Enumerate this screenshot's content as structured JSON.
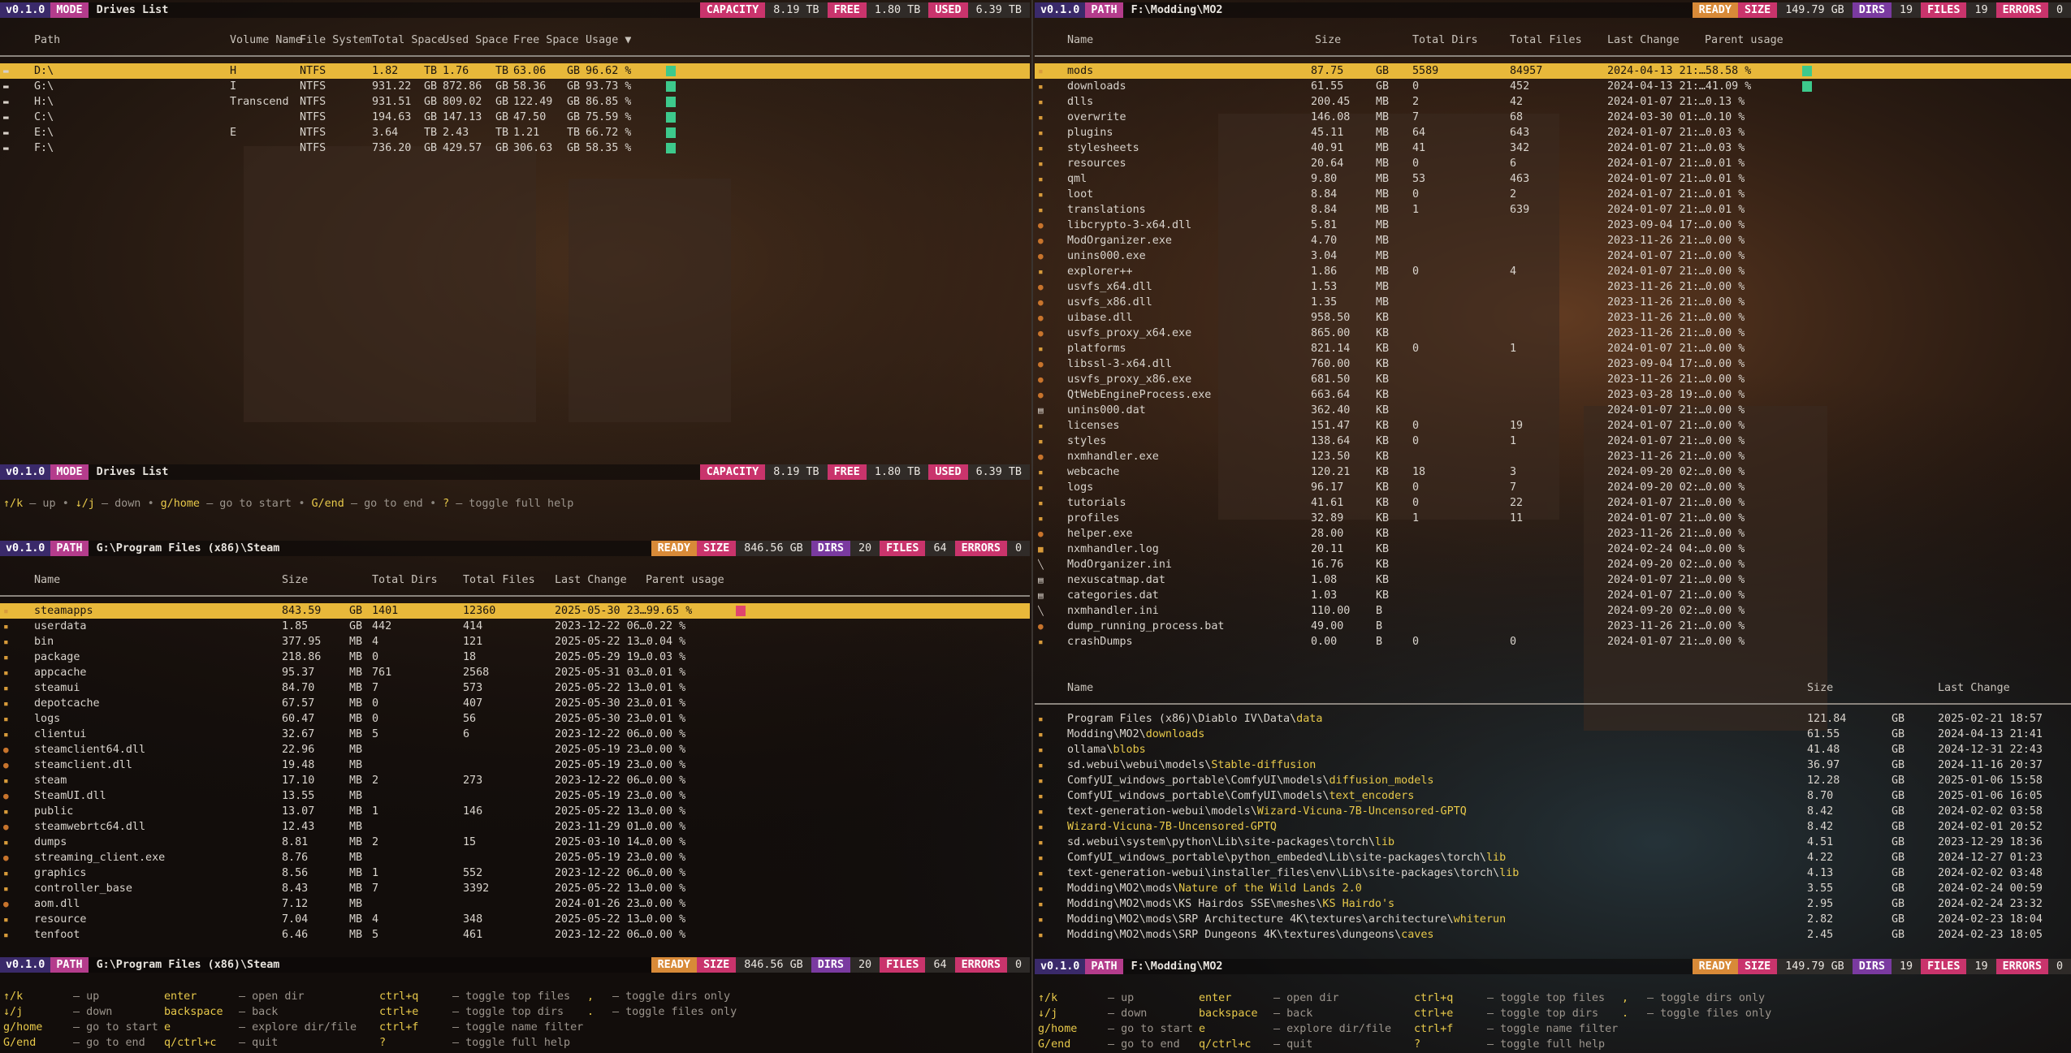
{
  "version": "v0.1.0",
  "drives": {
    "mode_label": "MODE",
    "title": "Drives List",
    "stats": {
      "capacity_label": "CAPACITY",
      "capacity": "8.19 TB",
      "free_label": "FREE",
      "free": "1.80 TB",
      "used_label": "USED",
      "used": "6.39 TB"
    },
    "columns": [
      "Path",
      "Volume Name",
      "File System",
      "Total Space",
      "Used Space",
      "Free Space",
      "Usage ▼"
    ],
    "rows": [
      {
        "path": "D:\\",
        "vol": "H",
        "fs": "NTFS",
        "total": "1.82",
        "tu": "TB",
        "used": "1.76",
        "uu": "TB",
        "free": "63.06",
        "fu": "GB",
        "usage": "96.62 %",
        "pct": 96.62
      },
      {
        "path": "G:\\",
        "vol": "I",
        "fs": "NTFS",
        "total": "931.22",
        "tu": "GB",
        "used": "872.86",
        "uu": "GB",
        "free": "58.36",
        "fu": "GB",
        "usage": "93.73 %",
        "pct": 93.73
      },
      {
        "path": "H:\\",
        "vol": "Transcend",
        "fs": "NTFS",
        "total": "931.51",
        "tu": "GB",
        "used": "809.02",
        "uu": "GB",
        "free": "122.49",
        "fu": "GB",
        "usage": "86.85 %",
        "pct": 86.85
      },
      {
        "path": "C:\\",
        "vol": "",
        "fs": "NTFS",
        "total": "194.63",
        "tu": "GB",
        "used": "147.13",
        "uu": "GB",
        "free": "47.50",
        "fu": "GB",
        "usage": "75.59 %",
        "pct": 75.59
      },
      {
        "path": "E:\\",
        "vol": "E",
        "fs": "NTFS",
        "total": "3.64",
        "tu": "TB",
        "used": "2.43",
        "uu": "TB",
        "free": "1.21",
        "fu": "TB",
        "usage": "66.72 %",
        "pct": 66.72
      },
      {
        "path": "F:\\",
        "vol": "",
        "fs": "NTFS",
        "total": "736.20",
        "tu": "GB",
        "used": "429.57",
        "uu": "GB",
        "free": "306.63",
        "fu": "GB",
        "usage": "58.35 %",
        "pct": 58.35
      }
    ],
    "help": [
      {
        "k": "↑/k",
        "d": "– up"
      },
      {
        "k": "↓/j",
        "d": "– down"
      },
      {
        "k": "g/home",
        "d": "– go to start"
      },
      {
        "k": "G/end",
        "d": "– go to end"
      },
      {
        "k": "?",
        "d": "– toggle full help"
      }
    ]
  },
  "steam": {
    "path_label": "PATH",
    "path": "G:\\Program Files (x86)\\Steam",
    "stats": {
      "ready": "READY",
      "size_label": "SIZE",
      "size": "846.56 GB",
      "dirs_label": "DIRS",
      "dirs": "20",
      "files_label": "FILES",
      "files": "64",
      "errors_label": "ERRORS",
      "errors": "0"
    },
    "columns": [
      "Name",
      "Size",
      "Total Dirs",
      "Total Files",
      "Last Change",
      "Parent usage"
    ],
    "rows": [
      {
        "i": "d",
        "n": "steamapps",
        "s": "843.59",
        "u": "GB",
        "td": "1401",
        "tf": "12360",
        "lc": "2025-05-30 23…99.65 %",
        "pct": 99.65
      },
      {
        "i": "d",
        "n": "userdata",
        "s": "1.85",
        "u": "GB",
        "td": "442",
        "tf": "414",
        "lc": "2023-12-22 06…0.22 %"
      },
      {
        "i": "d",
        "n": "bin",
        "s": "377.95",
        "u": "MB",
        "td": "4",
        "tf": "121",
        "lc": "2025-05-22 13…0.04 %"
      },
      {
        "i": "d",
        "n": "package",
        "s": "218.86",
        "u": "MB",
        "td": "0",
        "tf": "18",
        "lc": "2025-05-29 19…0.03 %"
      },
      {
        "i": "d",
        "n": "appcache",
        "s": "95.37",
        "u": "MB",
        "td": "761",
        "tf": "2568",
        "lc": "2025-05-31 03…0.01 %"
      },
      {
        "i": "d",
        "n": "steamui",
        "s": "84.70",
        "u": "MB",
        "td": "7",
        "tf": "573",
        "lc": "2025-05-22 13…0.01 %"
      },
      {
        "i": "d",
        "n": "depotcache",
        "s": "67.57",
        "u": "MB",
        "td": "0",
        "tf": "407",
        "lc": "2025-05-30 23…0.01 %"
      },
      {
        "i": "d",
        "n": "logs",
        "s": "60.47",
        "u": "MB",
        "td": "0",
        "tf": "56",
        "lc": "2025-05-30 23…0.01 %"
      },
      {
        "i": "d",
        "n": "clientui",
        "s": "32.67",
        "u": "MB",
        "td": "5",
        "tf": "6",
        "lc": "2023-12-22 06…0.00 %"
      },
      {
        "i": "f",
        "n": "steamclient64.dll",
        "s": "22.96",
        "u": "MB",
        "td": "",
        "tf": "",
        "lc": "2025-05-19 23…0.00 %"
      },
      {
        "i": "f",
        "n": "steamclient.dll",
        "s": "19.48",
        "u": "MB",
        "td": "",
        "tf": "",
        "lc": "2025-05-19 23…0.00 %"
      },
      {
        "i": "d",
        "n": "steam",
        "s": "17.10",
        "u": "MB",
        "td": "2",
        "tf": "273",
        "lc": "2023-12-22 06…0.00 %"
      },
      {
        "i": "f",
        "n": "SteamUI.dll",
        "s": "13.55",
        "u": "MB",
        "td": "",
        "tf": "",
        "lc": "2025-05-19 23…0.00 %"
      },
      {
        "i": "d",
        "n": "public",
        "s": "13.07",
        "u": "MB",
        "td": "1",
        "tf": "146",
        "lc": "2025-05-22 13…0.00 %"
      },
      {
        "i": "f",
        "n": "steamwebrtc64.dll",
        "s": "12.43",
        "u": "MB",
        "td": "",
        "tf": "",
        "lc": "2023-11-29 01…0.00 %"
      },
      {
        "i": "d",
        "n": "dumps",
        "s": "8.81",
        "u": "MB",
        "td": "2",
        "tf": "15",
        "lc": "2025-03-10 14…0.00 %"
      },
      {
        "i": "f",
        "n": "streaming_client.exe",
        "s": "8.76",
        "u": "MB",
        "td": "",
        "tf": "",
        "lc": "2025-05-19 23…0.00 %"
      },
      {
        "i": "d",
        "n": "graphics",
        "s": "8.56",
        "u": "MB",
        "td": "1",
        "tf": "552",
        "lc": "2023-12-22 06…0.00 %"
      },
      {
        "i": "d",
        "n": "controller_base",
        "s": "8.43",
        "u": "MB",
        "td": "7",
        "tf": "3392",
        "lc": "2025-05-22 13…0.00 %"
      },
      {
        "i": "f",
        "n": "aom.dll",
        "s": "7.12",
        "u": "MB",
        "td": "",
        "tf": "",
        "lc": "2024-01-26 23…0.00 %"
      },
      {
        "i": "d",
        "n": "resource",
        "s": "7.04",
        "u": "MB",
        "td": "4",
        "tf": "348",
        "lc": "2025-05-22 13…0.00 %"
      },
      {
        "i": "d",
        "n": "tenfoot",
        "s": "6.46",
        "u": "MB",
        "td": "5",
        "tf": "461",
        "lc": "2023-12-22 06…0.00 %"
      }
    ]
  },
  "mo2": {
    "path_label": "PATH",
    "path": "F:\\Modding\\MO2",
    "stats": {
      "ready": "READY",
      "size_label": "SIZE",
      "size": "149.79 GB",
      "dirs_label": "DIRS",
      "dirs": "19",
      "files_label": "FILES",
      "files": "19",
      "errors_label": "ERRORS",
      "errors": "0"
    },
    "columns": [
      "Name",
      "Size",
      "Total Dirs",
      "Total Files",
      "Last Change",
      "Parent usage"
    ],
    "rows": [
      {
        "i": "d",
        "n": "mods",
        "s": "87.75",
        "u": "GB",
        "td": "5589",
        "tf": "84957",
        "lc": "2024-04-13 21:…58.58 %",
        "pct": 58.58
      },
      {
        "i": "d",
        "n": "downloads",
        "s": "61.55",
        "u": "GB",
        "td": "0",
        "tf": "452",
        "lc": "2024-04-13 21:…41.09 %",
        "pct": 41.09
      },
      {
        "i": "d",
        "n": "dlls",
        "s": "200.45",
        "u": "MB",
        "td": "2",
        "tf": "42",
        "lc": "2024-01-07 21:…0.13 %"
      },
      {
        "i": "d",
        "n": "overwrite",
        "s": "146.08",
        "u": "MB",
        "td": "7",
        "tf": "68",
        "lc": "2024-03-30 01:…0.10 %"
      },
      {
        "i": "d",
        "n": "plugins",
        "s": "45.11",
        "u": "MB",
        "td": "64",
        "tf": "643",
        "lc": "2024-01-07 21:…0.03 %"
      },
      {
        "i": "d",
        "n": "stylesheets",
        "s": "40.91",
        "u": "MB",
        "td": "41",
        "tf": "342",
        "lc": "2024-01-07 21:…0.03 %"
      },
      {
        "i": "d",
        "n": "resources",
        "s": "20.64",
        "u": "MB",
        "td": "0",
        "tf": "6",
        "lc": "2024-01-07 21:…0.01 %"
      },
      {
        "i": "d",
        "n": "qml",
        "s": "9.80",
        "u": "MB",
        "td": "53",
        "tf": "463",
        "lc": "2024-01-07 21:…0.01 %"
      },
      {
        "i": "d",
        "n": "loot",
        "s": "8.84",
        "u": "MB",
        "td": "0",
        "tf": "2",
        "lc": "2024-01-07 21:…0.01 %"
      },
      {
        "i": "d",
        "n": "translations",
        "s": "8.84",
        "u": "MB",
        "td": "1",
        "tf": "639",
        "lc": "2024-01-07 21:…0.01 %"
      },
      {
        "i": "f",
        "n": "libcrypto-3-x64.dll",
        "s": "5.81",
        "u": "MB",
        "td": "",
        "tf": "",
        "lc": "2023-09-04 17:…0.00 %"
      },
      {
        "i": "f",
        "n": "ModOrganizer.exe",
        "s": "4.70",
        "u": "MB",
        "td": "",
        "tf": "",
        "lc": "2023-11-26 21:…0.00 %"
      },
      {
        "i": "f",
        "n": "unins000.exe",
        "s": "3.04",
        "u": "MB",
        "td": "",
        "tf": "",
        "lc": "2024-01-07 21:…0.00 %"
      },
      {
        "i": "d",
        "n": "explorer++",
        "s": "1.86",
        "u": "MB",
        "td": "0",
        "tf": "4",
        "lc": "2024-01-07 21:…0.00 %"
      },
      {
        "i": "f",
        "n": "usvfs_x64.dll",
        "s": "1.53",
        "u": "MB",
        "td": "",
        "tf": "",
        "lc": "2023-11-26 21:…0.00 %"
      },
      {
        "i": "f",
        "n": "usvfs_x86.dll",
        "s": "1.35",
        "u": "MB",
        "td": "",
        "tf": "",
        "lc": "2023-11-26 21:…0.00 %"
      },
      {
        "i": "f",
        "n": "uibase.dll",
        "s": "958.50",
        "u": "KB",
        "td": "",
        "tf": "",
        "lc": "2023-11-26 21:…0.00 %"
      },
      {
        "i": "f",
        "n": "usvfs_proxy_x64.exe",
        "s": "865.00",
        "u": "KB",
        "td": "",
        "tf": "",
        "lc": "2023-11-26 21:…0.00 %"
      },
      {
        "i": "d",
        "n": "platforms",
        "s": "821.14",
        "u": "KB",
        "td": "0",
        "tf": "1",
        "lc": "2024-01-07 21:…0.00 %"
      },
      {
        "i": "f",
        "n": "libssl-3-x64.dll",
        "s": "760.00",
        "u": "KB",
        "td": "",
        "tf": "",
        "lc": "2023-09-04 17:…0.00 %"
      },
      {
        "i": "f",
        "n": "usvfs_proxy_x86.exe",
        "s": "681.50",
        "u": "KB",
        "td": "",
        "tf": "",
        "lc": "2023-11-26 21:…0.00 %"
      },
      {
        "i": "f",
        "n": "QtWebEngineProcess.exe",
        "s": "663.64",
        "u": "KB",
        "td": "",
        "tf": "",
        "lc": "2023-03-28 19:…0.00 %"
      },
      {
        "i": "t",
        "n": "unins000.dat",
        "s": "362.40",
        "u": "KB",
        "td": "",
        "tf": "",
        "lc": "2024-01-07 21:…0.00 %"
      },
      {
        "i": "d",
        "n": "licenses",
        "s": "151.47",
        "u": "KB",
        "td": "0",
        "tf": "19",
        "lc": "2024-01-07 21:…0.00 %"
      },
      {
        "i": "d",
        "n": "styles",
        "s": "138.64",
        "u": "KB",
        "td": "0",
        "tf": "1",
        "lc": "2024-01-07 21:…0.00 %"
      },
      {
        "i": "f",
        "n": "nxmhandler.exe",
        "s": "123.50",
        "u": "KB",
        "td": "",
        "tf": "",
        "lc": "2023-11-26 21:…0.00 %"
      },
      {
        "i": "d",
        "n": "webcache",
        "s": "120.21",
        "u": "KB",
        "td": "18",
        "tf": "3",
        "lc": "2024-09-20 02:…0.00 %"
      },
      {
        "i": "d",
        "n": "logs",
        "s": "96.17",
        "u": "KB",
        "td": "0",
        "tf": "7",
        "lc": "2024-09-20 02:…0.00 %"
      },
      {
        "i": "d",
        "n": "tutorials",
        "s": "41.61",
        "u": "KB",
        "td": "0",
        "tf": "22",
        "lc": "2024-01-07 21:…0.00 %"
      },
      {
        "i": "d",
        "n": "profiles",
        "s": "32.89",
        "u": "KB",
        "td": "1",
        "tf": "11",
        "lc": "2024-01-07 21:…0.00 %"
      },
      {
        "i": "f",
        "n": "helper.exe",
        "s": "28.00",
        "u": "KB",
        "td": "",
        "tf": "",
        "lc": "2023-11-26 21:…0.00 %"
      },
      {
        "i": "g",
        "n": "nxmhandler.log",
        "s": "20.11",
        "u": "KB",
        "td": "",
        "tf": "",
        "lc": "2024-02-24 04:…0.00 %"
      },
      {
        "i": "w",
        "n": "ModOrganizer.ini",
        "s": "16.76",
        "u": "KB",
        "td": "",
        "tf": "",
        "lc": "2024-09-20 02:…0.00 %"
      },
      {
        "i": "t",
        "n": "nexuscatmap.dat",
        "s": "1.08",
        "u": "KB",
        "td": "",
        "tf": "",
        "lc": "2024-01-07 21:…0.00 %"
      },
      {
        "i": "t",
        "n": "categories.dat",
        "s": "1.03",
        "u": "KB",
        "td": "",
        "tf": "",
        "lc": "2024-01-07 21:…0.00 %"
      },
      {
        "i": "w",
        "n": "nxmhandler.ini",
        "s": "110.00",
        "u": "B",
        "td": "",
        "tf": "",
        "lc": "2024-09-20 02:…0.00 %"
      },
      {
        "i": "f",
        "n": "dump_running_process.bat",
        "s": "49.00",
        "u": "B",
        "td": "",
        "tf": "",
        "lc": "2023-11-26 21:…0.00 %"
      },
      {
        "i": "d",
        "n": "crashDumps",
        "s": "0.00",
        "u": "B",
        "td": "0",
        "tf": "0",
        "lc": "2024-01-07 21:…0.00 %"
      }
    ]
  },
  "largest": {
    "columns": [
      "Name",
      "Size",
      "Last Change"
    ],
    "rows": [
      {
        "p": "Program Files (x86)\\Diablo IV\\Data\\",
        "h": "data",
        "s": "121.84",
        "u": "GB",
        "lc": "2025-02-21 18:57"
      },
      {
        "p": "Modding\\MO2\\",
        "h": "downloads",
        "s": "61.55",
        "u": "GB",
        "lc": "2024-04-13 21:41"
      },
      {
        "p": "ollama\\",
        "h": "blobs",
        "s": "41.48",
        "u": "GB",
        "lc": "2024-12-31 22:43"
      },
      {
        "p": "sd.webui\\webui\\models\\",
        "h": "Stable-diffusion",
        "s": "36.97",
        "u": "GB",
        "lc": "2024-11-16 20:37"
      },
      {
        "p": "ComfyUI_windows_portable\\ComfyUI\\models\\",
        "h": "diffusion_models",
        "s": "12.28",
        "u": "GB",
        "lc": "2025-01-06 15:58"
      },
      {
        "p": "ComfyUI_windows_portable\\ComfyUI\\models\\",
        "h": "text_encoders",
        "s": "8.70",
        "u": "GB",
        "lc": "2025-01-06 16:05"
      },
      {
        "p": "text-generation-webui\\models\\",
        "h": "Wizard-Vicuna-7B-Uncensored-GPTQ",
        "s": "8.42",
        "u": "GB",
        "lc": "2024-02-02 03:58"
      },
      {
        "p": "",
        "h": "Wizard-Vicuna-7B-Uncensored-GPTQ",
        "s": "8.42",
        "u": "GB",
        "lc": "2024-02-01 20:52"
      },
      {
        "p": "sd.webui\\system\\python\\Lib\\site-packages\\torch\\",
        "h": "lib",
        "s": "4.51",
        "u": "GB",
        "lc": "2023-12-29 18:36"
      },
      {
        "p": "ComfyUI_windows_portable\\python_embeded\\Lib\\site-packages\\torch\\",
        "h": "lib",
        "s": "4.22",
        "u": "GB",
        "lc": "2024-12-27 01:23"
      },
      {
        "p": "text-generation-webui\\installer_files\\env\\Lib\\site-packages\\torch\\",
        "h": "lib",
        "s": "4.13",
        "u": "GB",
        "lc": "2024-02-02 03:48"
      },
      {
        "p": "Modding\\MO2\\mods\\",
        "h": "Nature of the Wild Lands 2.0",
        "s": "3.55",
        "u": "GB",
        "lc": "2024-02-24 00:59"
      },
      {
        "p": "Modding\\MO2\\mods\\KS Hairdos SSE\\meshes\\",
        "h": "KS Hairdo's",
        "s": "2.95",
        "u": "GB",
        "lc": "2024-02-24 23:32"
      },
      {
        "p": "Modding\\MO2\\mods\\SRP Architecture 4K\\textures\\architecture\\",
        "h": "whiterun",
        "s": "2.82",
        "u": "GB",
        "lc": "2024-02-23 18:04"
      },
      {
        "p": "Modding\\MO2\\mods\\SRP Dungeons 4K\\textures\\dungeons\\",
        "h": "caves",
        "s": "2.45",
        "u": "GB",
        "lc": "2024-02-23 18:05"
      }
    ]
  },
  "fullhelp": {
    "c1": [
      {
        "k": "↑/k",
        "d": "– up"
      },
      {
        "k": "↓/j",
        "d": "– down"
      },
      {
        "k": "g/home",
        "d": "– go to start"
      },
      {
        "k": "G/end",
        "d": "– go to end"
      }
    ],
    "c2": [
      {
        "k": "enter",
        "d": "– open dir"
      },
      {
        "k": "backspace",
        "d": "– back"
      },
      {
        "k": "e",
        "d": "– explore dir/file"
      },
      {
        "k": "q/ctrl+c",
        "d": "– quit"
      }
    ],
    "c3": [
      {
        "k": "ctrl+q",
        "d": "– toggle top files"
      },
      {
        "k": "ctrl+e",
        "d": "– toggle top dirs"
      },
      {
        "k": "ctrl+f",
        "d": "– toggle name filter"
      },
      {
        "k": "?",
        "d": "– toggle full help"
      }
    ],
    "c4": [
      {
        "k": ",",
        "d": "– toggle dirs only"
      },
      {
        "k": ".",
        "d": "– toggle files only"
      }
    ]
  },
  "colors": {
    "selected": "#e8b83a",
    "bar_used": "#e0456e",
    "bar_free": "#3dc98c",
    "highlight": "#e8c94a"
  }
}
